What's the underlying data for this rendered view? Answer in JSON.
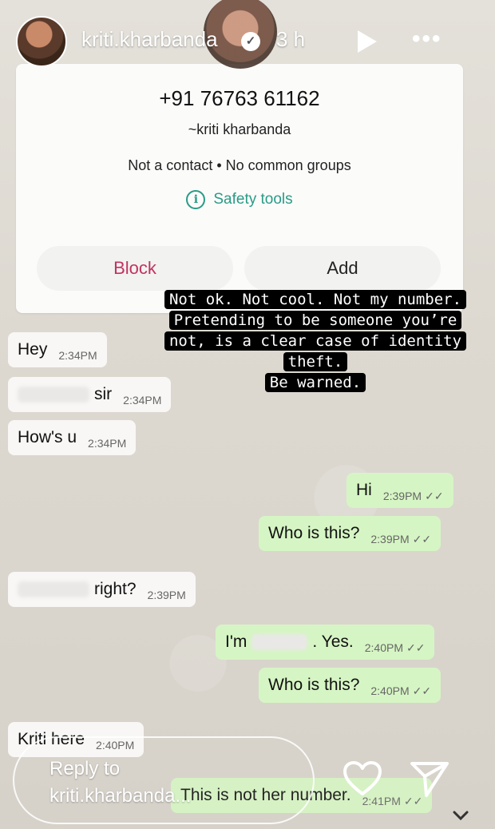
{
  "story": {
    "username": "kriti.kharbanda",
    "time_ago": "3 h"
  },
  "contact_card": {
    "phone": "+91 76763 61162",
    "name": "~kriti kharbanda",
    "info": "Not a contact • No common groups",
    "safety_label": "Safety tools",
    "block_label": "Block",
    "add_label": "Add"
  },
  "caption": {
    "lines": [
      "Not ok. Not cool. Not my number.",
      "Pretending to be someone you’re",
      "not, is a clear case of identity",
      "theft.",
      "Be warned."
    ]
  },
  "messages": [
    {
      "direction": "in",
      "text": "Hey",
      "time": "2:34PM"
    },
    {
      "direction": "in",
      "text": "sir",
      "time": "2:34PM"
    },
    {
      "direction": "in",
      "text": "How's u",
      "time": "2:34PM"
    },
    {
      "direction": "out",
      "text": "Hi",
      "time": "2:39PM"
    },
    {
      "direction": "out",
      "text": "Who is this?",
      "time": "2:39PM"
    },
    {
      "direction": "in",
      "text": "right?",
      "time": "2:39PM"
    },
    {
      "direction": "out",
      "text_prefix": "I'm",
      "text": ". Yes.",
      "time": "2:40PM"
    },
    {
      "direction": "out",
      "text": "Who is this?",
      "time": "2:40PM"
    },
    {
      "direction": "in",
      "text": "Kriti here",
      "time": "2:40PM"
    },
    {
      "direction": "out",
      "text": "This is not her number.",
      "time": "2:41PM"
    }
  ],
  "reply": {
    "line1": "Reply to",
    "line2": "kriti.kharbanda..."
  },
  "icons": {
    "verified": "verified-badge-icon",
    "play": "play-icon",
    "more": "more-icon",
    "heart": "heart-icon",
    "send": "send-icon",
    "safety": "info-icon",
    "chevron": "chevron-down-icon"
  }
}
